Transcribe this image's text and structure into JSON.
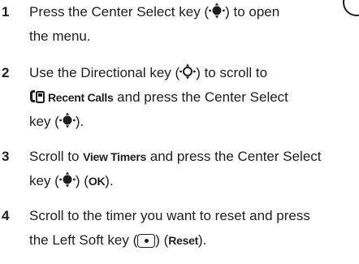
{
  "steps": [
    {
      "number": "1",
      "lines": [
        [
          "Press the Center Select key (",
          ") to open"
        ],
        [
          "the menu."
        ]
      ]
    },
    {
      "number": "2",
      "lines": [
        [
          "Use the Directional key (",
          ") to scroll to"
        ],
        [
          "Recent Calls",
          " and press the Center Select"
        ],
        [
          "key (",
          ")."
        ]
      ]
    },
    {
      "number": "3",
      "lines": [
        [
          "Scroll to ",
          "View Timers",
          " and press the Center Select"
        ],
        [
          "key (",
          ") (",
          "OK",
          ")."
        ]
      ]
    },
    {
      "number": "4",
      "lines": [
        [
          "Scroll to the timer you want to reset and press"
        ],
        [
          "the Left Soft key (",
          ") (",
          "Reset",
          ")."
        ]
      ]
    }
  ],
  "icons": {
    "center_select": "center-select-key-icon",
    "directional": "directional-key-icon",
    "recent_calls": "recent-calls-icon",
    "left_soft": "left-soft-key-icon"
  }
}
